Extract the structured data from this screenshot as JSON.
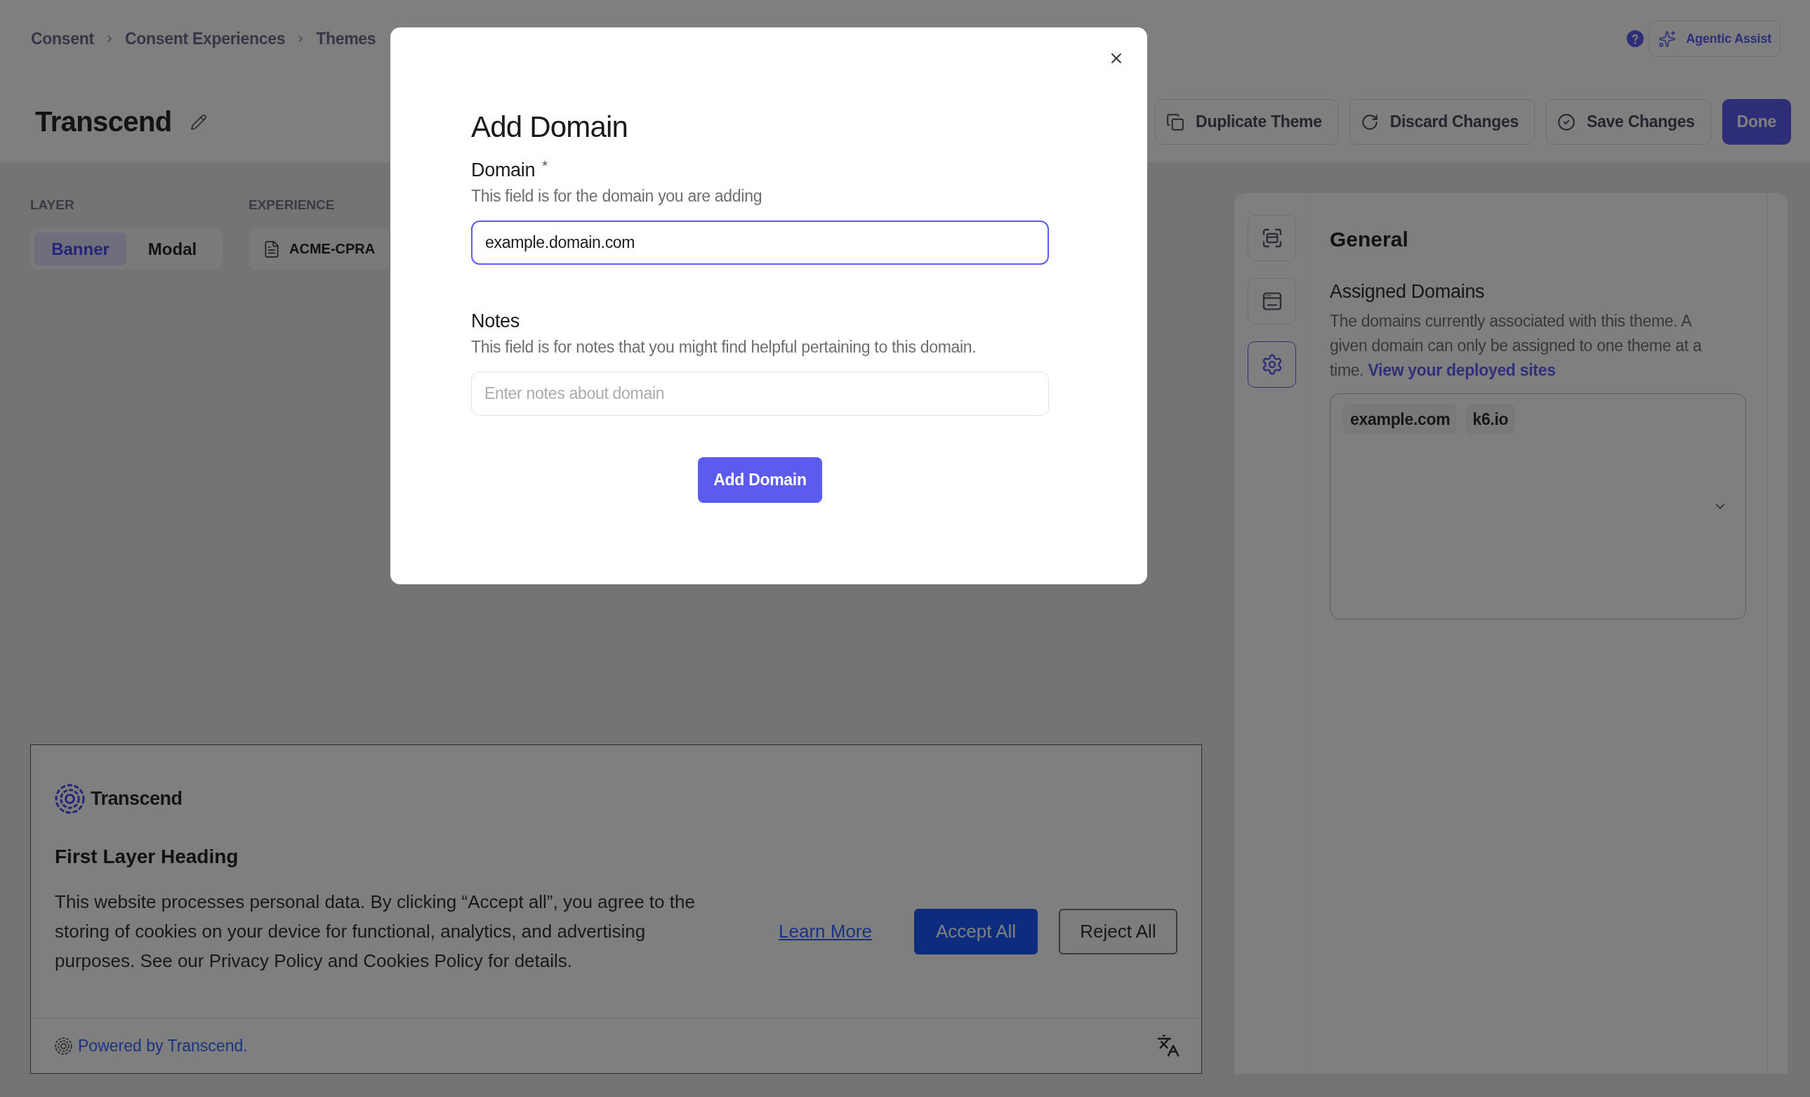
{
  "breadcrumbs": [
    "Consent",
    "Consent Experiences",
    "Themes"
  ],
  "assistant_button": {
    "label": "Agentic Assist"
  },
  "page_title": "Transcend",
  "toolbar": [
    {
      "label": "Duplicate Theme",
      "kind": "outline"
    },
    {
      "label": "Discard Changes",
      "kind": "outline"
    },
    {
      "label": "Save Changes",
      "kind": "outline"
    },
    {
      "label": "Done",
      "kind": "primary"
    }
  ],
  "layer": {
    "label": "LAYER",
    "options": [
      {
        "label": "Banner",
        "selected": true
      },
      {
        "label": "Modal",
        "selected": false
      }
    ]
  },
  "experience": {
    "label": "EXPERIENCE",
    "value": "ACME-CPRA"
  },
  "banner_preview": {
    "logo_text": "Transcend",
    "heading": "First Layer Heading",
    "body": "This website processes personal data. By clicking “Accept all”, you agree to the storing of cookies on your device for functional, analytics, and advertising purposes. See our Privacy Policy and Cookies Policy for details.",
    "link": "Learn More",
    "buttons": [
      {
        "label": "Accept All",
        "kind": "primary"
      },
      {
        "label": "Reject All",
        "kind": "secondary"
      }
    ],
    "footer_link": "Powered by Transcend."
  },
  "settings_panel": {
    "tabs": [
      {
        "selected": false
      },
      {
        "selected": false
      },
      {
        "selected": true
      }
    ],
    "title": "General",
    "section": {
      "title": "Assigned Domains",
      "description": "The domains currently associated with this theme. A given domain can only be assigned to one theme at a time.",
      "link": "View your deployed sites",
      "domains": [
        "example.com",
        "k6.io"
      ]
    }
  },
  "modal": {
    "title": "Add Domain",
    "fields": [
      {
        "label": "Domain",
        "required_mark": "*",
        "help": "This field is for the domain you are adding",
        "value": "example.domain.com",
        "focused": true
      },
      {
        "label": "Notes",
        "help": "This field is for notes that you might find helpful pertaining to this domain.",
        "placeholder": "Enter notes about domain",
        "focused": false
      }
    ],
    "submit": "Add Domain"
  }
}
